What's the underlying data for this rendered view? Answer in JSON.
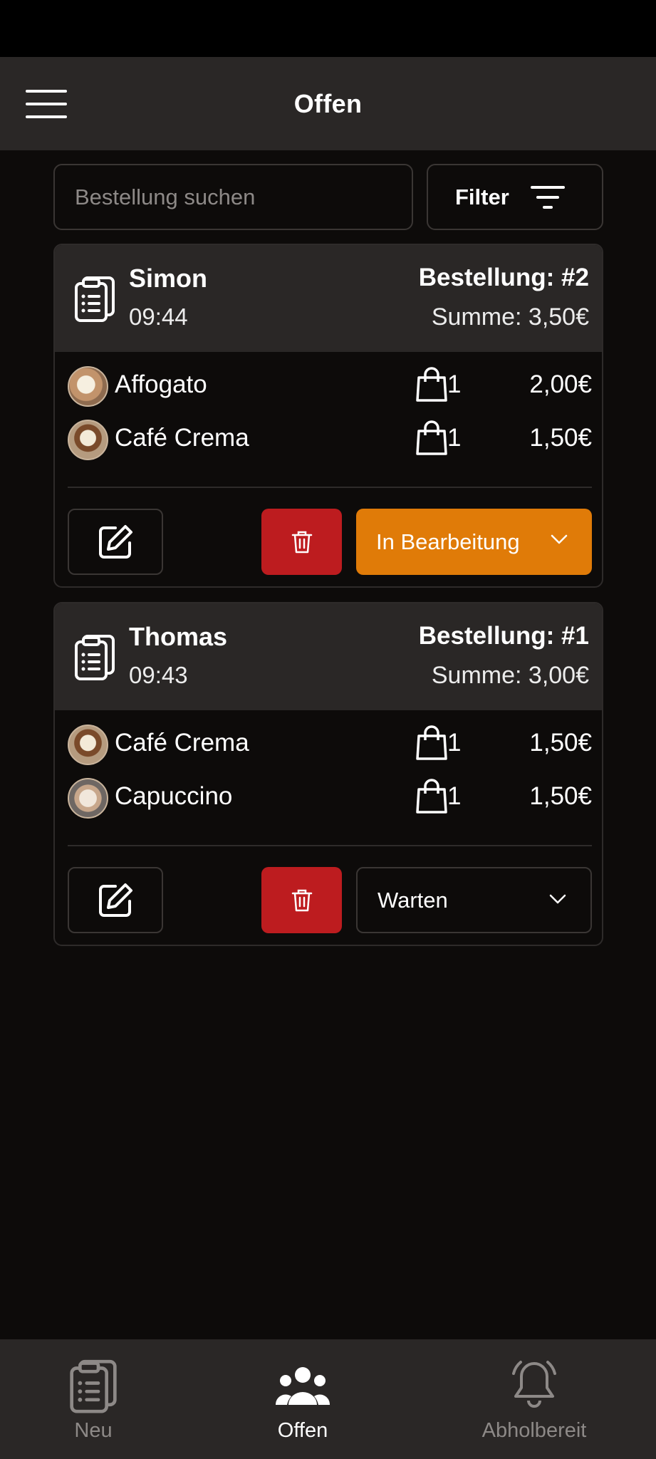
{
  "app_bar": {
    "title": "Offen",
    "menu_icon": "hamburger-menu-icon"
  },
  "search": {
    "placeholder": "Bestellung suchen",
    "value": ""
  },
  "filter": {
    "label": "Filter",
    "icon": "filter-icon"
  },
  "orders": [
    {
      "customer": "Simon",
      "time": "09:44",
      "order_number": "Bestellung: #2",
      "sum": "Summe: 3,50€",
      "items": [
        {
          "name": "Affogato",
          "qty": "1",
          "price": "2,00€"
        },
        {
          "name": "Café Crema",
          "qty": "1",
          "price": "1,50€"
        }
      ],
      "status": "In Bearbeitung"
    },
    {
      "customer": "Thomas",
      "time": "09:43",
      "order_number": "Bestellung: #1",
      "sum": "Summe: 3,00€",
      "items": [
        {
          "name": "Café Crema",
          "qty": "1",
          "price": "1,50€"
        },
        {
          "name": "Capuccino",
          "qty": "1",
          "price": "1,50€"
        }
      ],
      "status": "Warten"
    }
  ],
  "bottom_nav": [
    {
      "label": "Neu",
      "icon": "clipboard-icon",
      "active": false
    },
    {
      "label": "Offen",
      "icon": "people-icon",
      "active": true
    },
    {
      "label": "Abholbereit",
      "icon": "bell-icon",
      "active": false
    }
  ],
  "colors": {
    "background": "#0d0b0a",
    "surface": "#2a2726",
    "status_processing": "#e07b08",
    "delete": "#bd1c1f"
  }
}
